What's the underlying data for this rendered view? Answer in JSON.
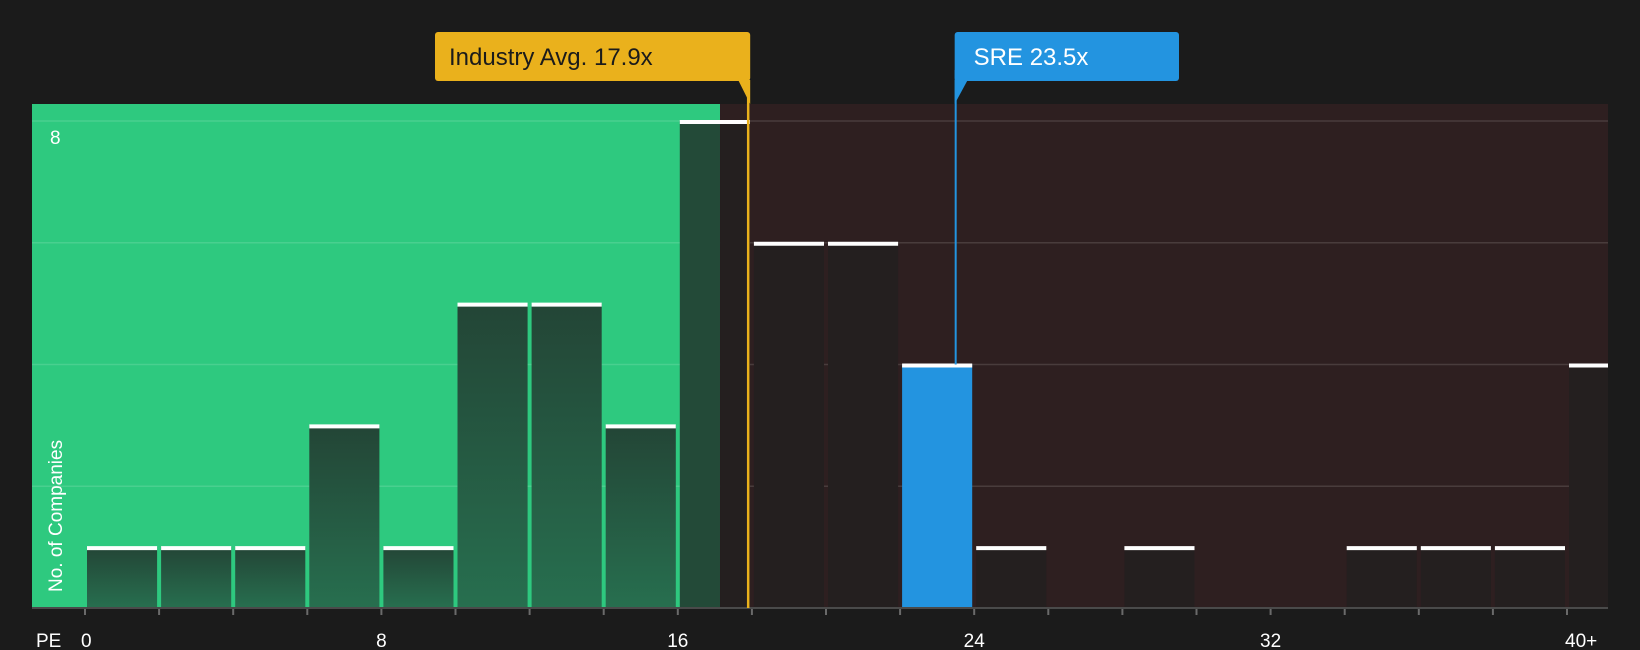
{
  "chart_data": {
    "type": "bar",
    "xlabel": "PE",
    "ylabel": "No. of Companies",
    "x_ticks": [
      "0",
      "8",
      "16",
      "24",
      "32",
      "40+"
    ],
    "y_ticks": [
      "8"
    ],
    "ylim": [
      0,
      8
    ],
    "bin_width": 2,
    "bins": [
      {
        "x0": 0,
        "x1": 2,
        "count": 1
      },
      {
        "x0": 2,
        "x1": 4,
        "count": 1
      },
      {
        "x0": 4,
        "x1": 6,
        "count": 1
      },
      {
        "x0": 6,
        "x1": 8,
        "count": 3
      },
      {
        "x0": 8,
        "x1": 10,
        "count": 1
      },
      {
        "x0": 10,
        "x1": 12,
        "count": 5
      },
      {
        "x0": 12,
        "x1": 14,
        "count": 5
      },
      {
        "x0": 14,
        "x1": 16,
        "count": 3
      },
      {
        "x0": 16,
        "x1": 18,
        "count": 8
      },
      {
        "x0": 18,
        "x1": 20,
        "count": 6
      },
      {
        "x0": 20,
        "x1": 22,
        "count": 6
      },
      {
        "x0": 22,
        "x1": 24,
        "count": 4,
        "highlight": true
      },
      {
        "x0": 24,
        "x1": 26,
        "count": 1
      },
      {
        "x0": 26,
        "x1": 28,
        "count": 0
      },
      {
        "x0": 28,
        "x1": 30,
        "count": 1
      },
      {
        "x0": 30,
        "x1": 32,
        "count": 0
      },
      {
        "x0": 32,
        "x1": 34,
        "count": 0
      },
      {
        "x0": 34,
        "x1": 36,
        "count": 1
      },
      {
        "x0": 36,
        "x1": 38,
        "count": 1
      },
      {
        "x0": 38,
        "x1": 40,
        "count": 1
      },
      {
        "x0": 40,
        "x1": 42,
        "count": 4
      }
    ],
    "industry_avg": {
      "label": "Industry Avg. 17.9x",
      "value": 17.9
    },
    "company": {
      "label": "SRE 23.5x",
      "value": 23.5
    },
    "colors": {
      "background": "#1b1b1b",
      "undervalued_zone": "#2ec97f",
      "overvalued_zone": "#2e1f20",
      "bar_in_green": "#234a38",
      "bar_in_dark": "#241f1f",
      "bar_highlight": "#2394e0",
      "bar_cap": "#ffffff",
      "industry_marker": "#eab11c",
      "company_marker": "#2394e0"
    }
  }
}
